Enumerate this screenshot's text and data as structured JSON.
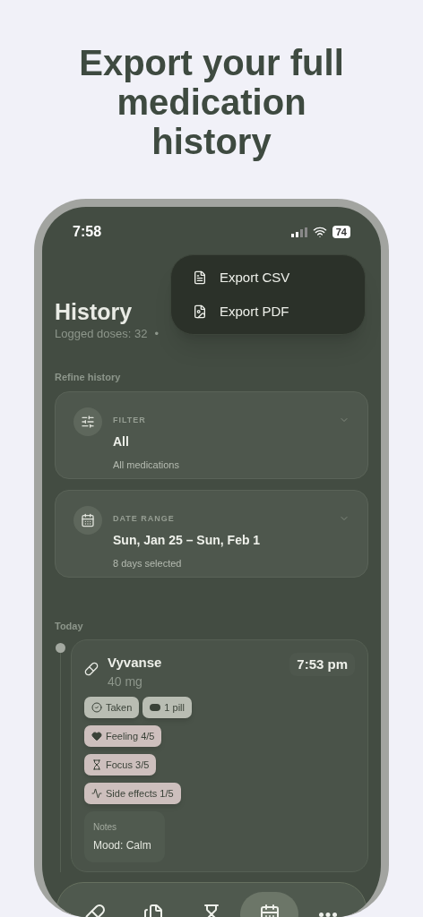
{
  "headline": "Export your full medication history",
  "status_bar": {
    "time": "7:58",
    "battery": "74"
  },
  "export_menu": [
    {
      "kind": "csv",
      "label": "Export CSV"
    },
    {
      "kind": "pdf",
      "label": "Export PDF"
    }
  ],
  "page": {
    "title": "History",
    "subtitle": "Logged doses: 32",
    "separator": "•"
  },
  "refine": {
    "heading": "Refine history",
    "cards": [
      {
        "kind": "filter",
        "label": "FILTER",
        "value": "All",
        "detail": "All medications"
      },
      {
        "kind": "date",
        "label": "DATE RANGE",
        "value": "Sun, Jan 25 – Sun, Feb 1",
        "detail": "8 days selected"
      }
    ]
  },
  "timeline": {
    "heading": "Today",
    "entries": [
      {
        "name": "Vyvanse",
        "dose": "40 mg",
        "time": "7:53 pm",
        "tags": [
          [
            {
              "kind": "taken",
              "label": "Taken"
            },
            {
              "kind": "pill",
              "label": "1 pill"
            }
          ],
          [
            {
              "kind": "feeling",
              "label": "Feeling 4/5"
            }
          ],
          [
            {
              "kind": "focus",
              "label": "Focus 3/5"
            }
          ],
          [
            {
              "kind": "side",
              "label": "Side effects 1/5"
            }
          ]
        ],
        "notes": {
          "label": "Notes",
          "text": "Mood: Calm"
        }
      }
    ]
  },
  "tab_bar": [
    {
      "kind": "pill",
      "selected": false
    },
    {
      "kind": "notes",
      "selected": false
    },
    {
      "kind": "hourglass",
      "selected": false
    },
    {
      "kind": "calendar",
      "selected": true
    },
    {
      "kind": "more",
      "selected": false
    }
  ]
}
